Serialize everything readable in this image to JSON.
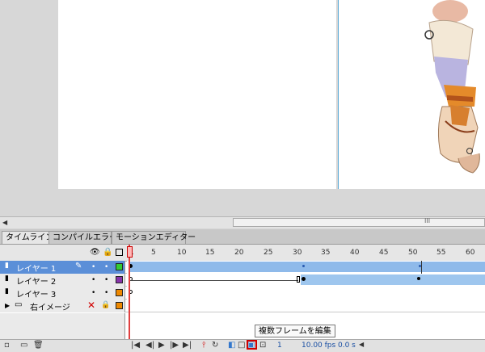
{
  "tabs": [
    "タイムライン",
    "コンパイルエラー",
    "モーションエディター"
  ],
  "ruler": [
    "1",
    "5",
    "10",
    "15",
    "20",
    "25",
    "30",
    "35",
    "40",
    "45",
    "50",
    "55",
    "60"
  ],
  "layers": [
    {
      "name": "レイヤー 1",
      "color": "#33cc33",
      "selected": true
    },
    {
      "name": "レイヤー 2",
      "color": "#8833aa",
      "selected": false
    },
    {
      "name": "レイヤー 3",
      "color": "#ee8800",
      "selected": false
    },
    {
      "name": "右イメージ",
      "color": "#ee8800",
      "selected": false
    }
  ],
  "status": {
    "frame": "1",
    "fps": "10.00 fps",
    "time": "0.0 s"
  },
  "tooltip": "複数フレームを編集",
  "hscroll": {
    "grip": "III"
  },
  "icons": {
    "eye": "eye-icon",
    "lock": "lock-icon",
    "outline": "outline-icon"
  }
}
